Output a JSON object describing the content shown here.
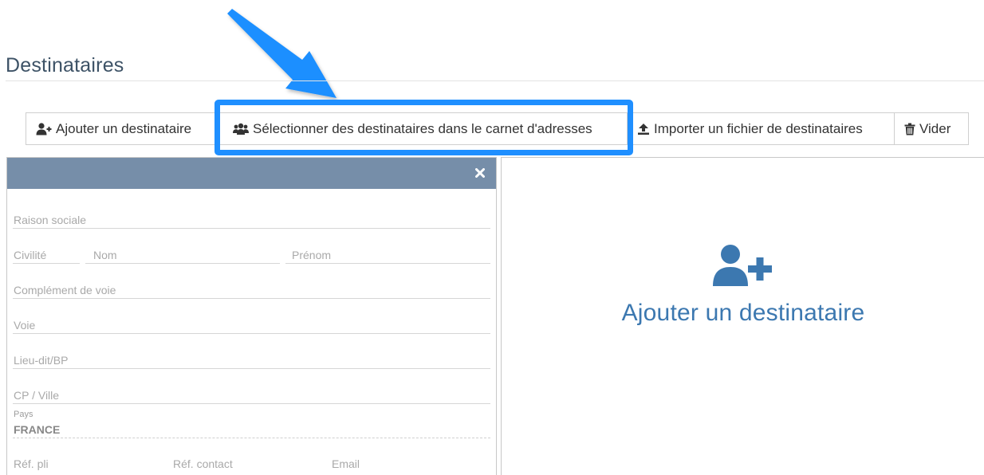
{
  "page": {
    "title": "Destinataires"
  },
  "toolbar": {
    "add_recipient": {
      "label": "Ajouter un destinataire",
      "icon": "user-plus-icon"
    },
    "select_from_address_book": {
      "label": "Sélectionner des destinataires dans le carnet d'adresses",
      "icon": "users-icon"
    },
    "import_file": {
      "label": "Importer un fichier de destinataires",
      "icon": "upload-icon"
    },
    "clear": {
      "label": "Vider",
      "icon": "trash-icon"
    }
  },
  "annotation": {
    "highlight_color": "#1f8fff",
    "arrow_color": "#1f8fff"
  },
  "form": {
    "header_color": "#768ea9",
    "close_icon": "close-icon",
    "fields": {
      "raison_sociale": "Raison sociale",
      "civilite": "Civilité",
      "nom": "Nom",
      "prenom": "Prénom",
      "complement_voie": "Complément de voie",
      "voie": "Voie",
      "lieu_dit": "Lieu-dit/BP",
      "cp_ville": "CP / Ville",
      "pays_label": "Pays",
      "pays_value": "FRANCE",
      "ref_pli": "Réf. pli",
      "ref_contact": "Réf. contact",
      "email": "Email"
    }
  },
  "add_panel": {
    "label": "Ajouter un destinataire",
    "icon": "user-plus-icon",
    "color": "#3c78b0"
  }
}
